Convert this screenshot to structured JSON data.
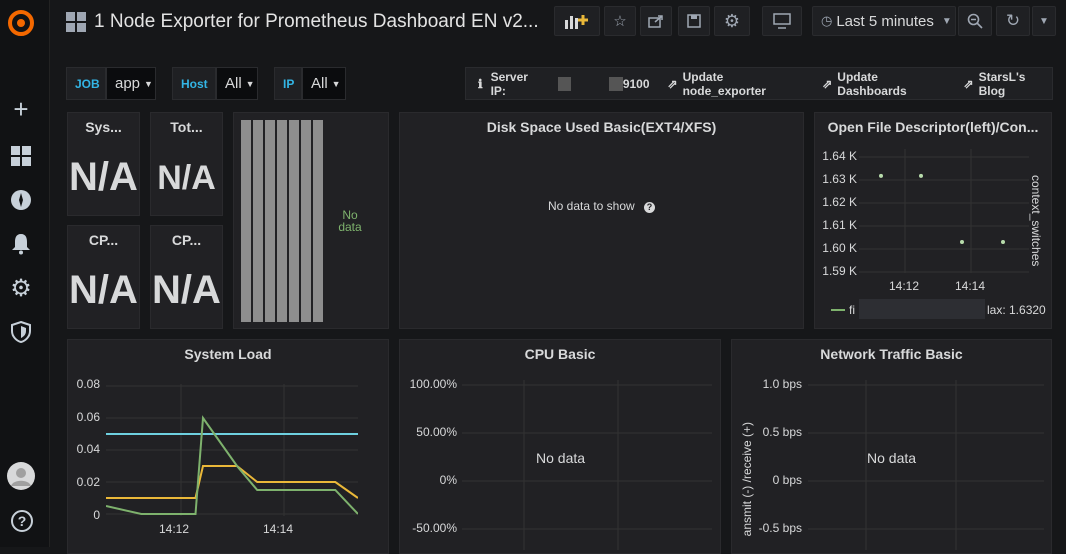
{
  "topbar": {
    "title": "1 Node Exporter for Prometheus Dashboard EN v2...",
    "time_range": "Last 5 minutes"
  },
  "variables": {
    "job_label": "JOB",
    "job_value": "app",
    "host_label": "Host",
    "host_value": "All",
    "ip_label": "IP",
    "ip_value": "All"
  },
  "links": {
    "server_ip_label": "Server IP:",
    "server_ip_suffix": "9100",
    "update_node_exporter": "Update node_exporter",
    "update_dashboards": "Update Dashboards",
    "blog": "StarsL's Blog"
  },
  "stats": [
    {
      "title": "Sys...",
      "value": "N/A"
    },
    {
      "title": "Tot...",
      "value": "N/A"
    },
    {
      "title": "CP...",
      "value": "N/A"
    },
    {
      "title": "CP...",
      "value": "N/A"
    }
  ],
  "bar_gauge": {
    "no_data": "No data"
  },
  "disk_panel": {
    "title": "Disk Space Used Basic(EXT4/XFS)",
    "message": "No data to show"
  },
  "ofd_panel": {
    "title": "Open File Descriptor(left)/Con...",
    "yticks": [
      "1.64 K",
      "1.63 K",
      "1.62 K",
      "1.61 K",
      "1.60 K",
      "1.59 K"
    ],
    "xticks": [
      "14:12",
      "14:14"
    ],
    "right_axis": "context_switches",
    "legend_name": "fi",
    "legend_max": "lax: 1.6320"
  },
  "system_load": {
    "title": "System Load",
    "yticks": [
      "0.08",
      "0.06",
      "0.04",
      "0.02",
      "0"
    ],
    "xticks": [
      "14:12",
      "14:14"
    ]
  },
  "cpu_panel": {
    "title": "CPU Basic",
    "yticks": [
      "100.00%",
      "50.00%",
      "0%",
      "-50.00%"
    ],
    "no_data": "No data"
  },
  "net_panel": {
    "title": "Network Traffic Basic",
    "yticks": [
      "1.0 bps",
      "0.5 bps",
      "0 bps",
      "-0.5 bps"
    ],
    "axis_label": "ansmit (-) /receive (+)",
    "no_data": "No data"
  },
  "chart_data": [
    {
      "type": "line",
      "title": "System Load",
      "x": [
        "14:10",
        "14:11",
        "14:12",
        "14:12:30",
        "14:13",
        "14:13:30",
        "14:14",
        "14:15"
      ],
      "ylim": [
        0,
        0.08
      ],
      "series": [
        {
          "color": "#6ed0e0",
          "values": [
            0.05,
            0.05,
            0.05,
            0.05,
            0.05,
            0.05,
            0.05,
            0.05
          ]
        },
        {
          "color": "#eab839",
          "values": [
            0.01,
            0.01,
            0.01,
            0.03,
            0.03,
            0.02,
            0.02,
            0.01
          ]
        },
        {
          "color": "#7eb26d",
          "values": [
            0.005,
            0.0,
            0.0,
            0.06,
            0.03,
            0.015,
            0.015,
            0.0
          ]
        }
      ]
    },
    {
      "type": "scatter",
      "title": "Open File Descriptor(left)/Con...",
      "ylim": [
        1.585,
        1.645
      ],
      "points": [
        {
          "x": "14:11:20",
          "y": 1.632
        },
        {
          "x": "14:12:20",
          "y": 1.632
        },
        {
          "x": "14:13:50",
          "y": 1.6
        },
        {
          "x": "14:14:50",
          "y": 1.6
        }
      ],
      "color": "#b7dbab"
    }
  ],
  "colors": {
    "accent_blue": "#33b5e5",
    "panel_bg": "#212124",
    "bar_gray": "#8e8e8e"
  }
}
